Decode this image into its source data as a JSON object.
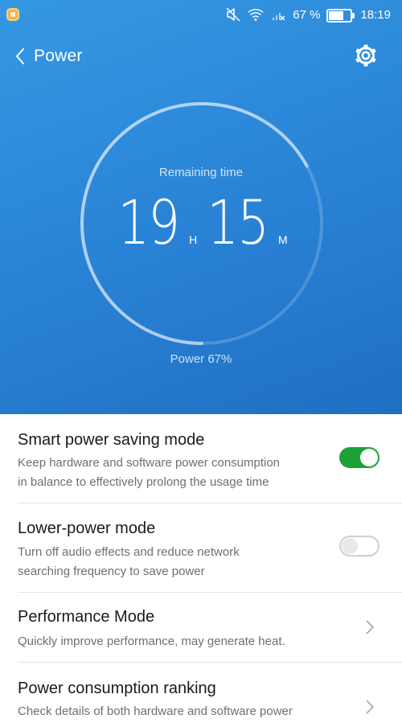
{
  "status_bar": {
    "app_icon": "notification-app-icon",
    "icons": [
      "mute-icon",
      "wifi-icon",
      "no-signal-icon"
    ],
    "battery_text": "67 %",
    "battery_level": 0.67,
    "time": "18:19"
  },
  "header": {
    "back_icon": "chevron-left-icon",
    "title": "Power",
    "settings_icon": "gear-icon"
  },
  "gauge": {
    "label": "Remaining time",
    "hours": "19",
    "hours_unit": "H",
    "minutes": "15",
    "minutes_unit": "M",
    "power_text": "Power 67%",
    "level": 0.67
  },
  "settings": [
    {
      "title": "Smart power saving mode",
      "desc_line1": "Keep hardware and software power consumption",
      "desc_line2": "in balance to effectively prolong the usage time",
      "control": "toggle",
      "on": true
    },
    {
      "title": "Lower-power mode",
      "desc_line1": "Turn off audio effects and reduce network",
      "desc_line2": "searching frequency to save power",
      "control": "toggle",
      "on": false
    },
    {
      "title": "Performance Mode",
      "desc_line1": "Quickly improve performance, may generate heat.",
      "control": "chevron"
    },
    {
      "title": "Power consumption ranking",
      "desc_line1": "Check details of both hardware and software power",
      "control": "chevron"
    }
  ],
  "colors": {
    "hero_blue": "#2b86d8",
    "toggle_on": "#1da136",
    "title_text": "#1a1a1a",
    "desc_text": "#6f6f6f"
  }
}
